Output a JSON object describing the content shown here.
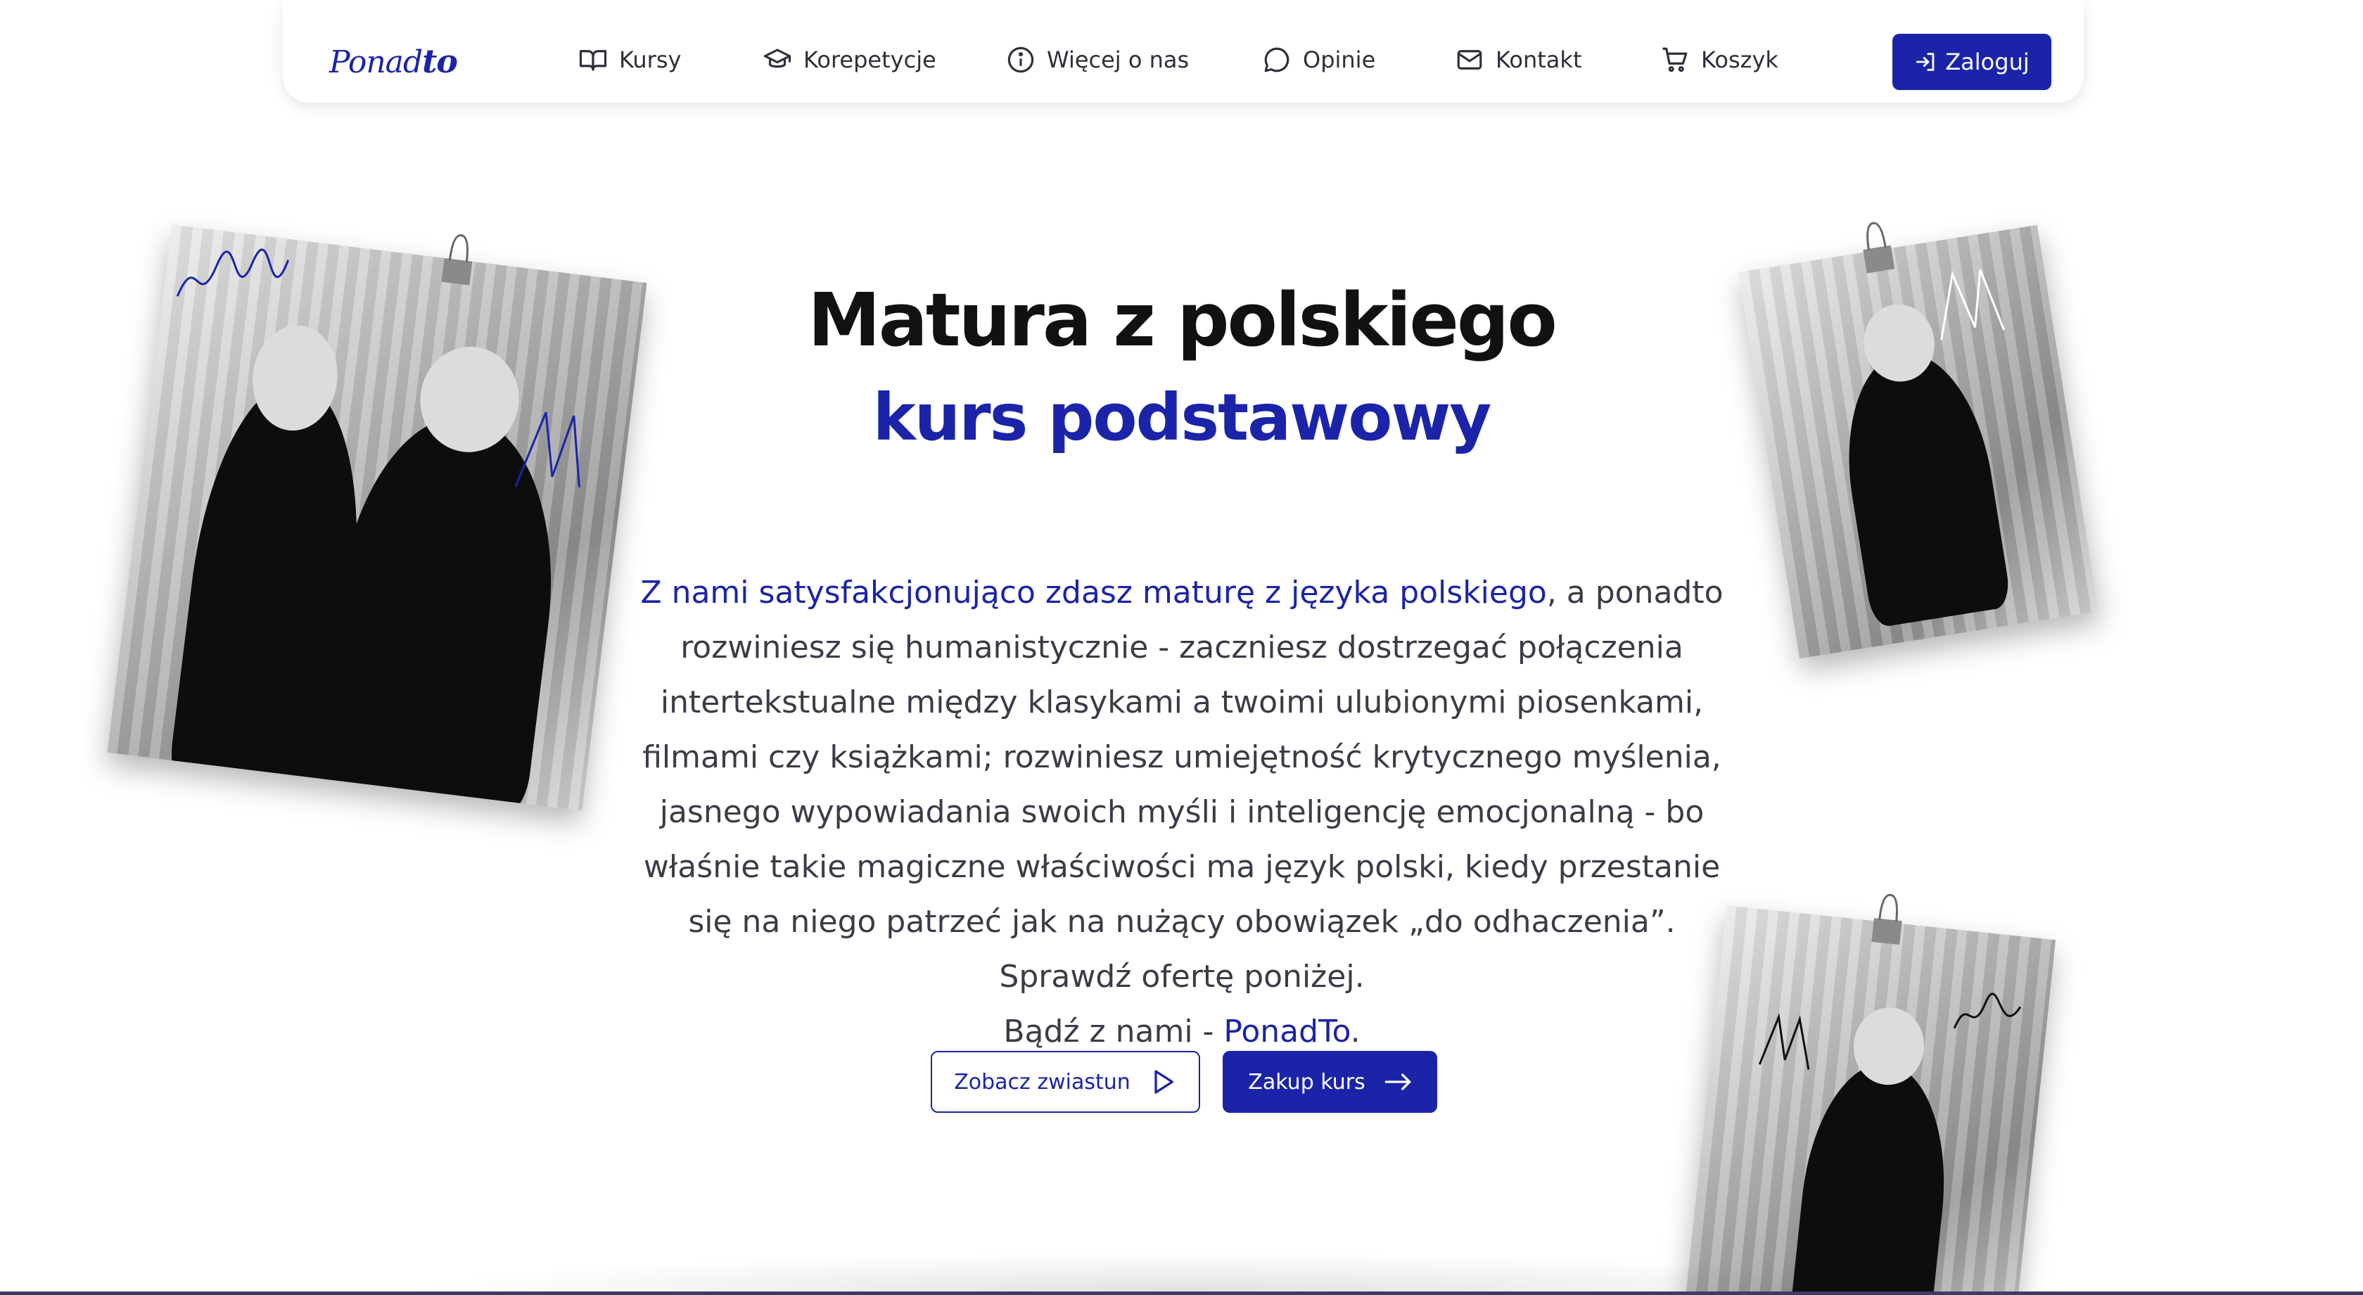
{
  "navbar": {
    "logo": {
      "main": "Ponad",
      "suffix": "to"
    },
    "items": [
      {
        "label": "Kursy",
        "icon": "book-icon"
      },
      {
        "label": "Korepetycje",
        "icon": "graduation-cap-icon"
      },
      {
        "label": "Więcej o nas",
        "icon": "info-icon"
      },
      {
        "label": "Opinie",
        "icon": "chat-bubble-icon"
      },
      {
        "label": "Kontakt",
        "icon": "mail-icon"
      },
      {
        "label": "Koszyk",
        "icon": "cart-icon"
      }
    ],
    "login_label": "Zaloguj"
  },
  "hero": {
    "title": "Matura z polskiego",
    "subtitle": "kurs podstawowy",
    "desc_highlight": "Z nami satysfakcjonująco zdasz maturę z języka polskiego",
    "desc_rest": ", a ponadto rozwiniesz się humanistycznie - zaczniesz dostrzegać połączenia intertekstualne między klasykami a twoimi ulubionymi piosenkami, filmami czy książkami; rozwiniesz umiejętność krytycznego myślenia, jasnego wypowiadania swoich myśli i inteligencję emocjonalną - bo właśnie takie magiczne właściwości ma język polski, kiedy przestanie się na niego patrzeć jak na nużący obowiązek „do odhaczenia”. Sprawdź ofertę poniżej.",
    "tagline_prefix": "Bądź z nami - ",
    "tagline_brand": "PonadTo",
    "tagline_suffix": ".",
    "trailer_button": "Zobacz zwiastun",
    "buy_button": "Zakup kurs"
  },
  "colors": {
    "accent": "#1b24a8",
    "text": "#2d2f3a"
  }
}
